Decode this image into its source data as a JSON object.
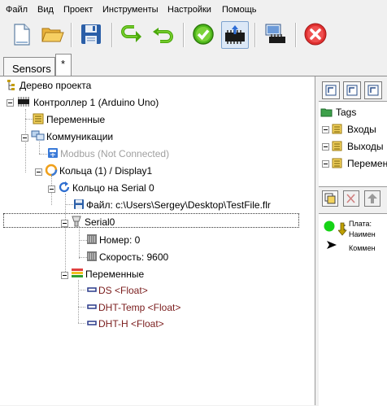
{
  "menu": [
    "Файл",
    "Вид",
    "Проект",
    "Инструменты",
    "Настройки",
    "Помощь"
  ],
  "toolbar": {
    "buttons": [
      "new-file-icon",
      "open-folder-icon",
      "save-icon",
      "undo-icon",
      "redo-icon",
      "check-icon",
      "upload-icon",
      "monitor-icon",
      "stop-icon"
    ]
  },
  "tabs": {
    "sensors": "Sensors",
    "new_tab": "*"
  },
  "tree": {
    "root": "Дерево проекта",
    "controller": "Контроллер 1 (Arduino Uno)",
    "variables": "Переменные",
    "communications": "Коммуникации",
    "modbus": "Modbus (Not Connected)",
    "rings": "Кольца (1) / Display1",
    "ring": "Кольцо  на Serial 0",
    "file": "Файл: c:\\Users\\Sergey\\Desktop\\TestFile.flr",
    "serial": "Serial0",
    "number": "Номер: 0",
    "speed": "Скорость: 9600",
    "ring_vars": "Переменные",
    "var1": "DS <Float>",
    "var2": "DHT-Temp <Float>",
    "var3": "DHT-H <Float>"
  },
  "tags": {
    "root": "Tags",
    "inputs": "Входы",
    "outputs": "Выходы",
    "variables": "Перемен"
  },
  "props": {
    "board": "Плата:",
    "name": "Наимен",
    "comment": "Коммен"
  },
  "colors": {
    "variable_text": "#7a1c1c",
    "disabled_text": "#a0a0a0",
    "status_green": "#16d316",
    "stop_red": "#e03030"
  }
}
